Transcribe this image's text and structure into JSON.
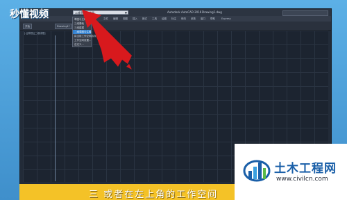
{
  "branding": {
    "logo_text": "秒懂视频"
  },
  "app": {
    "workspace_value": "二维草图与注释",
    "app_name": "Autodesk AutoCAD 2016",
    "doc_name": "Drawing1.dwg",
    "menu_items": [
      "文件",
      "编辑",
      "视图",
      "插入",
      "格式",
      "工具",
      "绘图",
      "标注",
      "修改",
      "参数",
      "窗口",
      "帮助",
      "Express"
    ],
    "tabs": [
      "开始",
      "Drawing1*"
    ],
    "dropdown_items": [
      "草图与注释",
      "三维基础",
      "三维建模",
      "二维草图与注释",
      "将当前工作空间另存为...",
      "工作空间设置...",
      "自定义..."
    ],
    "dropdown_selected_index": 3,
    "view_label": "[-][俯视][二维线框]"
  },
  "subtitle": "三 或者在左上角的工作空间",
  "watermark": {
    "title": "土木工程网",
    "url": "www.civilcn.com"
  },
  "colors": {
    "background": "#4fa0d8",
    "subtitle_bar": "#f4c227",
    "arrow": "#d8191d",
    "watermark_blue": "#1a5fa8"
  }
}
